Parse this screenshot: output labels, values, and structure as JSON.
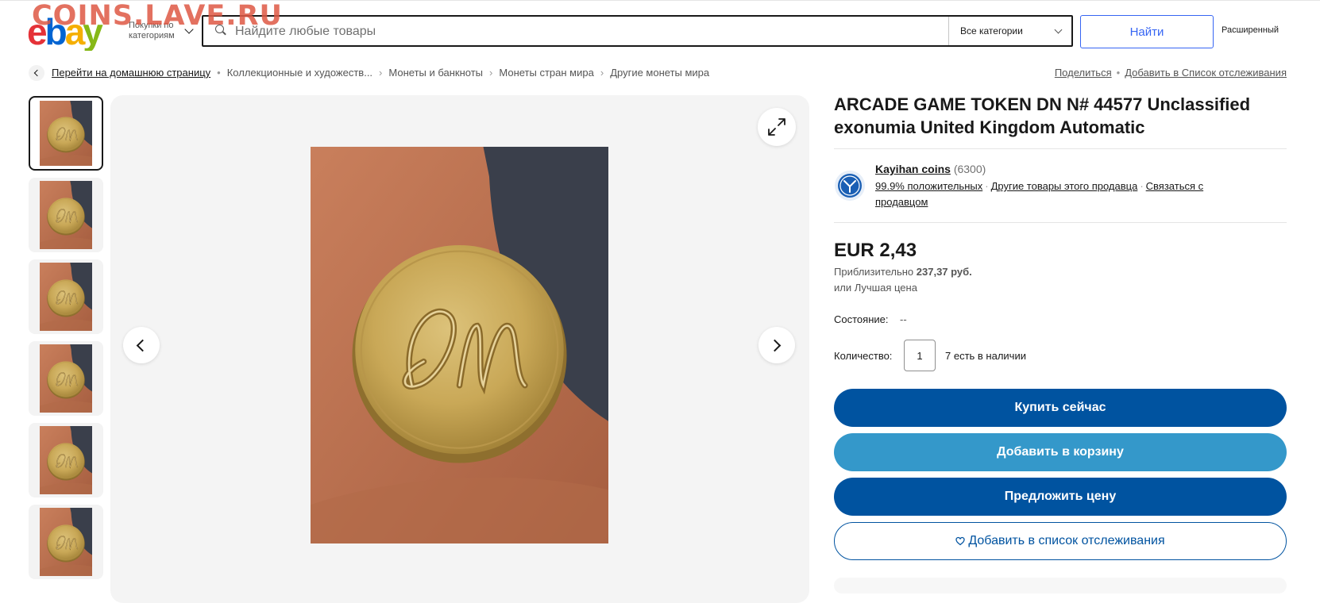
{
  "watermark": "COINS.LAVE.RU",
  "header": {
    "shop_by_category": "Покупки по категориям",
    "search_placeholder": "Найдите любые товары",
    "category_select": "Все категории",
    "search_button": "Найти",
    "advanced": "Расширенный"
  },
  "breadcrumb": [
    "Перейти на домашнюю страницу",
    "Коллекционные и художеств...",
    "Монеты и банкноты",
    "Монеты стран мира",
    "Другие монеты мира"
  ],
  "actions": {
    "share": "Поделиться",
    "watchlist": "Добавить в Список отслеживания"
  },
  "gallery": {
    "thumbnail_count": 6,
    "active_thumbnail": 1
  },
  "item": {
    "title": "ARCADE GAME TOKEN DN N# 44577 Unclassified exonumia United Kingdom Automatic",
    "price": "EUR 2,43",
    "approx_prefix": "Приблизительно",
    "approx_value": "237,37 руб.",
    "best_offer": "или Лучшая цена",
    "condition_label": "Состояние:",
    "condition_value": "--",
    "quantity_label": "Количество:",
    "quantity_value": "1",
    "available": "7 есть в наличии"
  },
  "seller": {
    "name": "Kayihan coins",
    "feedback_count": "(6300)",
    "positive": "99.9% положительных",
    "other_items": "Другие товары этого продавца",
    "contact": "Связаться с продавцом"
  },
  "buttons": {
    "buy_now": "Купить сейчас",
    "add_to_cart": "Добавить в корзину",
    "make_offer": "Предложить цену",
    "add_to_watchlist": "Добавить в список отслеживания"
  },
  "colors": {
    "primary": "#0053a0",
    "cart": "#3498ca",
    "link_blue": "#3665f3",
    "ebay_red": "#e53238",
    "ebay_blue": "#0064d2",
    "ebay_yellow": "#f5af02",
    "ebay_green": "#86b817"
  }
}
